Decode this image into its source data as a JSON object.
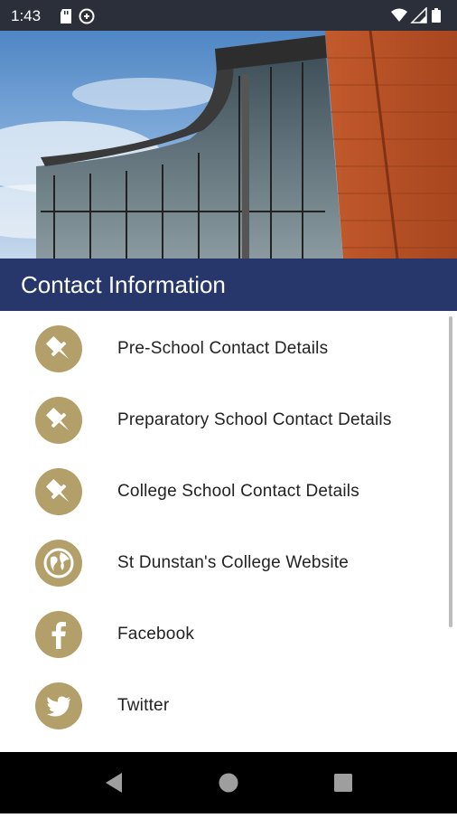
{
  "status_bar": {
    "time": "1:43",
    "left_icons": [
      "sd-card-icon",
      "data-saver-icon"
    ],
    "right_icons": [
      "wifi-icon",
      "cellular-signal-icon",
      "battery-icon"
    ]
  },
  "hero": {
    "image": "college-building-photo"
  },
  "header": {
    "title": "Contact Information"
  },
  "colors": {
    "header_bg": "#27376b",
    "icon_gold": "#b29f69",
    "status_bg": "#2a2f3a"
  },
  "list": {
    "items": [
      {
        "label": "Pre-School Contact Details",
        "icon": "pin-icon"
      },
      {
        "label": "Preparatory School Contact Details",
        "icon": "pin-icon"
      },
      {
        "label": "College School Contact Details",
        "icon": "pin-icon"
      },
      {
        "label": "St Dunstan's College Website",
        "icon": "globe-icon"
      },
      {
        "label": "Facebook",
        "icon": "facebook-icon"
      },
      {
        "label": "Twitter",
        "icon": "twitter-icon"
      }
    ]
  },
  "nav_bar": {
    "buttons": [
      "back-icon",
      "home-icon",
      "recents-icon"
    ]
  }
}
